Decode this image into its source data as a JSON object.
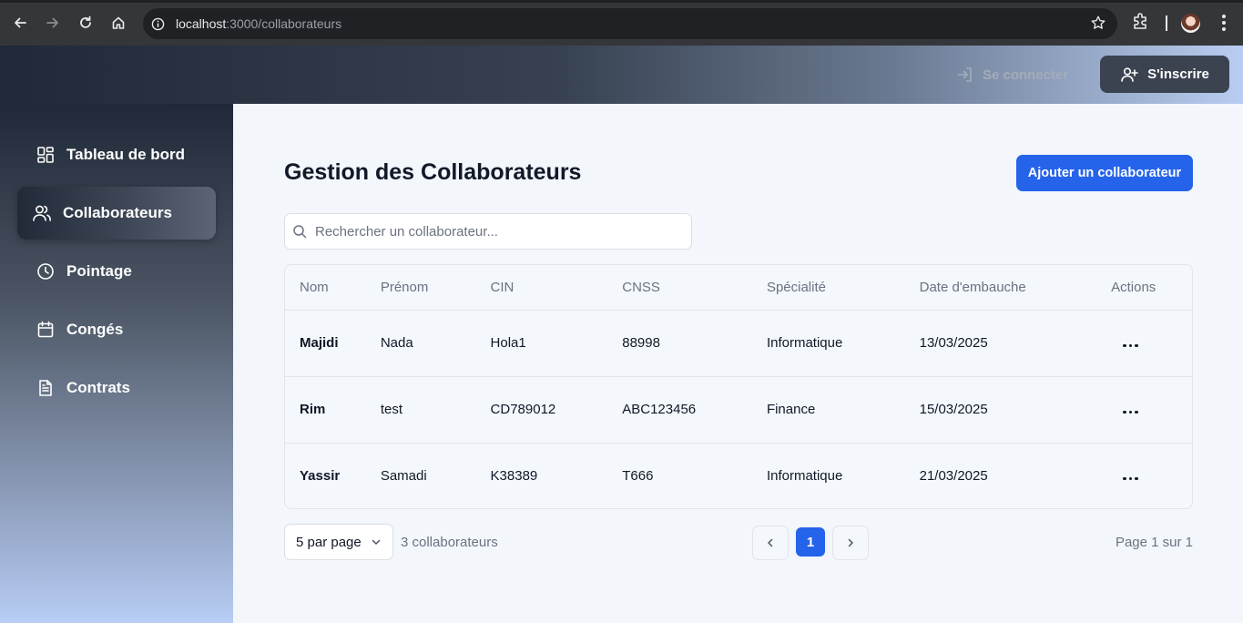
{
  "browser": {
    "url_host": "localhost",
    "url_path": ":3000/collaborateurs"
  },
  "header": {
    "login_label": "Se connecter",
    "signup_label": "S'inscrire"
  },
  "sidebar": {
    "items": [
      {
        "label": "Tableau de bord",
        "icon": "dashboard-icon"
      },
      {
        "label": "Collaborateurs",
        "icon": "users-icon",
        "active": true
      },
      {
        "label": "Pointage",
        "icon": "clock-icon"
      },
      {
        "label": "Congés",
        "icon": "calendar-icon"
      },
      {
        "label": "Contrats",
        "icon": "document-icon"
      }
    ]
  },
  "main": {
    "title": "Gestion des Collaborateurs",
    "add_button": "Ajouter un collaborateur",
    "search_placeholder": "Rechercher un collaborateur...",
    "columns": [
      "Nom",
      "Prénom",
      "CIN",
      "CNSS",
      "Spécialité",
      "Date d'embauche",
      "Actions"
    ],
    "rows": [
      {
        "nom": "Majidi",
        "prenom": "Nada",
        "cin": "Hola1",
        "cnss": "88998",
        "specialite": "Informatique",
        "date": "13/03/2025"
      },
      {
        "nom": "Rim",
        "prenom": "test",
        "cin": "CD789012",
        "cnss": "ABC123456",
        "specialite": "Finance",
        "date": "15/03/2025"
      },
      {
        "nom": "Yassir",
        "prenom": "Samadi",
        "cin": "K38389",
        "cnss": "T666",
        "specialite": "Informatique",
        "date": "21/03/2025"
      }
    ],
    "pagination": {
      "page_size": "5 par page",
      "count": "3 collaborateurs",
      "current_page": "1",
      "page_info": "Page 1 sur 1"
    }
  },
  "colors": {
    "primary": "#2563eb",
    "sidebar_top": "#1f2937",
    "sidebar_bottom": "#b8cdf5"
  }
}
